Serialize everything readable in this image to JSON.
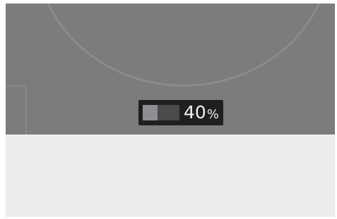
{
  "brightness": {
    "value": "40",
    "unit": "%",
    "level_fraction": 0.4
  }
}
